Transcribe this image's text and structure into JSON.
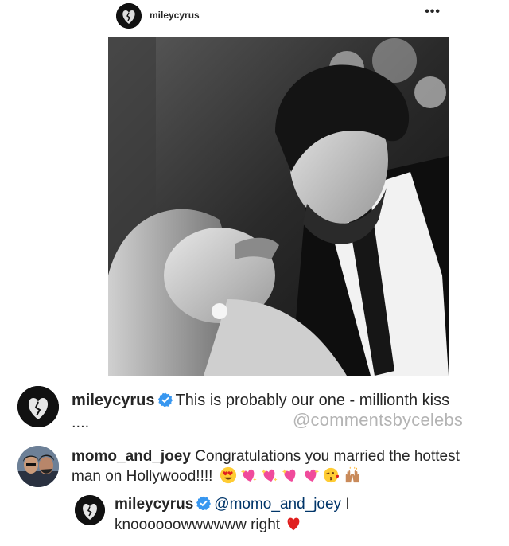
{
  "post": {
    "username": "mileycyrus",
    "more_icon": "more-horizontal-icon",
    "more_label": "•••",
    "photo_icon": "post-photo"
  },
  "comments": [
    {
      "username": "mileycyrus",
      "verified": true,
      "text": "This is probably our one - millionth kiss",
      "continuation": "....",
      "watermark": "@commentsbycelebs"
    },
    {
      "username": "momo_and_joey",
      "verified": false,
      "text": "Congratulations you married the hottest man on Hollywood!!!!",
      "emojis": [
        "heart-eyes-emoji",
        "sparkling-heart-emoji",
        "sparkling-heart-emoji",
        "sparkling-heart-emoji",
        "sparkling-heart-emoji",
        "kissing-heart-emoji",
        "raising-hands-emoji"
      ]
    },
    {
      "username": "mileycyrus",
      "verified": true,
      "mention": "@momo_and_joey",
      "text": "I knoooooowwwwww right",
      "emoji": "red-heart-emoji"
    }
  ],
  "colors": {
    "verified_blue": "#3897f0",
    "mention_blue": "#003569",
    "watermark_gray": "#b4b4b4",
    "heart_red": "#e0201f",
    "pink_heart": "#f04b9b"
  }
}
